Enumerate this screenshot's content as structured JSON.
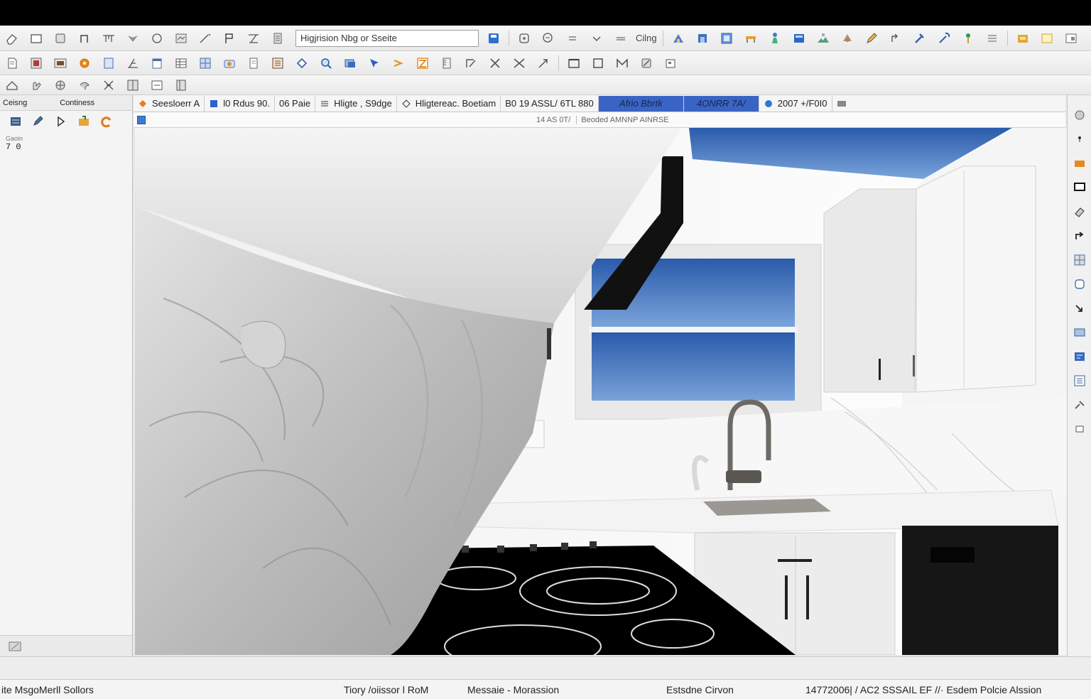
{
  "toolbar": {
    "search_value": "Higjrision Nbg or Sseite",
    "text_button": "Cilng"
  },
  "left_panel": {
    "tab1": "Ceisng",
    "tab2": "Continess",
    "small_label": "Gaoin",
    "value": "7 0"
  },
  "options_bar": {
    "item1": "Seesloerr A",
    "item2": "l0 Rdus 90.",
    "item3": "06 Paie",
    "item4": "Hligte , S9dge",
    "item5": "Hligtereac.  Boetiam",
    "item6": "B0 19 ASSL/ 6TL 880",
    "item7": "Afrio Bbrtk",
    "item8": "4ONRR 7A/",
    "item9": "2007 +/F0I0"
  },
  "sub_bar": {
    "text1": "14 AS 0T/",
    "text2": "Beoded AMNNP AINRSE"
  },
  "status": {
    "left": "ite MsgoMerll Sollors",
    "s1": "Tiory /oiissor l RoM",
    "s2": "Messaie  -  Morassion",
    "s3": "Estsdne Cirvon",
    "s4": "14772006| / AC2 SSSAIL EF //·  Esdem Polcie  Alssion"
  },
  "colors": {
    "accent": "#3a64c4",
    "sky": "#3f6fb8",
    "toolbar_bg": "#efefef"
  }
}
